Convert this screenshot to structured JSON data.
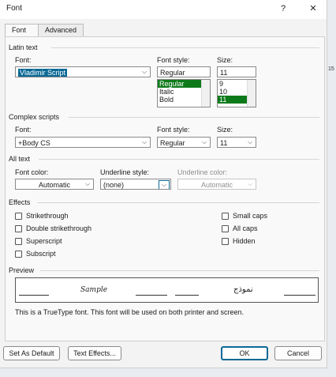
{
  "window": {
    "title": "Font",
    "help_glyph": "?",
    "close_glyph": "✕"
  },
  "side_text": "15",
  "tabs": [
    {
      "label": "Font"
    },
    {
      "label": "Advanced"
    }
  ],
  "latin": {
    "group": "Latin text",
    "font_label": "Font:",
    "font_value": "Vladimir Script",
    "style_label": "Font style:",
    "style_value": "Regular",
    "style_options": [
      "Regular",
      "Italic",
      "Bold"
    ],
    "size_label": "Size:",
    "size_value": "11",
    "size_options": [
      "9",
      "10",
      "11"
    ]
  },
  "complex": {
    "group": "Complex scripts",
    "font_label": "Font:",
    "font_value": "+Body CS",
    "style_label": "Font style:",
    "style_value": "Regular",
    "size_label": "Size:",
    "size_value": "11"
  },
  "alltext": {
    "group": "All text",
    "color_label": "Font color:",
    "color_value": "Automatic",
    "underline_style_label": "Underline style:",
    "underline_style_value": "(none)",
    "underline_color_label": "Underline color:",
    "underline_color_value": "Automatic"
  },
  "effects": {
    "group": "Effects",
    "items": [
      "Strikethrough",
      "Double strikethrough",
      "Superscript",
      "Subscript",
      "Small caps",
      "All caps",
      "Hidden"
    ]
  },
  "preview": {
    "group": "Preview",
    "sample": "Sample",
    "arabic": "نموذج",
    "note": "This is a TrueType font. This font will be used on both printer and screen."
  },
  "buttons": {
    "set_default": "Set As Default",
    "text_effects": "Text Effects...",
    "ok": "OK",
    "cancel": "Cancel"
  }
}
